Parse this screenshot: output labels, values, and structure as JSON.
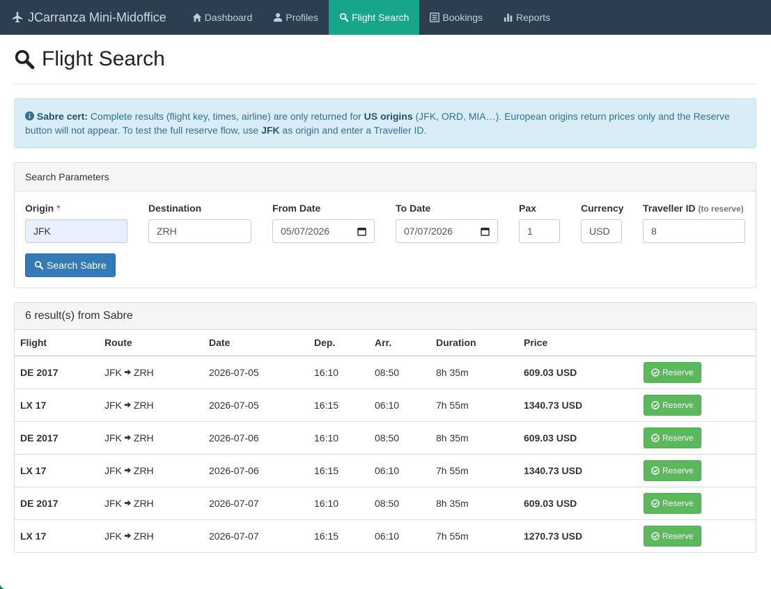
{
  "nav": {
    "brand": "JCarranza Mini-Midoffice",
    "items": [
      {
        "label": "Dashboard",
        "icon": "home-icon"
      },
      {
        "label": "Profiles",
        "icon": "user-icon"
      },
      {
        "label": "Flight Search",
        "icon": "search-icon",
        "active": true
      },
      {
        "label": "Bookings",
        "icon": "list-icon"
      },
      {
        "label": "Reports",
        "icon": "bar-chart-icon"
      }
    ]
  },
  "page": {
    "title": "Flight Search"
  },
  "alert": {
    "lead": "Sabre cert:",
    "t1": " Complete results (flight key, times, airline) are only returned for ",
    "b1": "US origins",
    "t2": " (JFK, ORD, MIA…). European origins return prices only and the Reserve button will not appear. To test the full reserve flow, use ",
    "b2": "JFK",
    "t3": " as origin and enter a Traveller ID."
  },
  "search": {
    "heading": "Search Parameters",
    "origin_label": "Origin",
    "required_mark": "*",
    "origin_value": "JFK",
    "destination_label": "Destination",
    "destination_value": "ZRH",
    "from_label": "From Date",
    "from_value": "05/07/2026",
    "to_label": "To Date",
    "to_value": "07/07/2026",
    "pax_label": "Pax",
    "pax_value": "1",
    "currency_label": "Currency",
    "currency_value": "USD",
    "traveller_label": "Traveller ID",
    "traveller_hint": "(to reserve)",
    "traveller_value": "8",
    "button": "Search Sabre"
  },
  "results": {
    "heading": "6 result(s) from Sabre",
    "columns": [
      "Flight",
      "Route",
      "Date",
      "Dep.",
      "Arr.",
      "Duration",
      "Price",
      ""
    ],
    "reserve_label": "Reserve",
    "rows": [
      {
        "flight": "DE 2017",
        "from": "JFK",
        "to": "ZRH",
        "date": "2026-07-05",
        "dep": "16:10",
        "arr": "08:50",
        "duration": "8h 35m",
        "price": "609.03 USD"
      },
      {
        "flight": "LX 17",
        "from": "JFK",
        "to": "ZRH",
        "date": "2026-07-05",
        "dep": "16:15",
        "arr": "06:10",
        "duration": "7h 55m",
        "price": "1340.73 USD"
      },
      {
        "flight": "DE 2017",
        "from": "JFK",
        "to": "ZRH",
        "date": "2026-07-06",
        "dep": "16:10",
        "arr": "08:50",
        "duration": "8h 35m",
        "price": "609.03 USD"
      },
      {
        "flight": "LX 17",
        "from": "JFK",
        "to": "ZRH",
        "date": "2026-07-06",
        "dep": "16:15",
        "arr": "06:10",
        "duration": "7h 55m",
        "price": "1340.73 USD"
      },
      {
        "flight": "DE 2017",
        "from": "JFK",
        "to": "ZRH",
        "date": "2026-07-07",
        "dep": "16:10",
        "arr": "08:50",
        "duration": "8h 35m",
        "price": "609.03 USD"
      },
      {
        "flight": "LX 17",
        "from": "JFK",
        "to": "ZRH",
        "date": "2026-07-07",
        "dep": "16:15",
        "arr": "06:10",
        "duration": "7h 55m",
        "price": "1270.73 USD"
      }
    ]
  },
  "colors": {
    "navbar": "#2c3e50",
    "active_tab": "#18a68a",
    "primary": "#337ab7",
    "success": "#5cb85c",
    "info_bg": "#d9edf7"
  }
}
